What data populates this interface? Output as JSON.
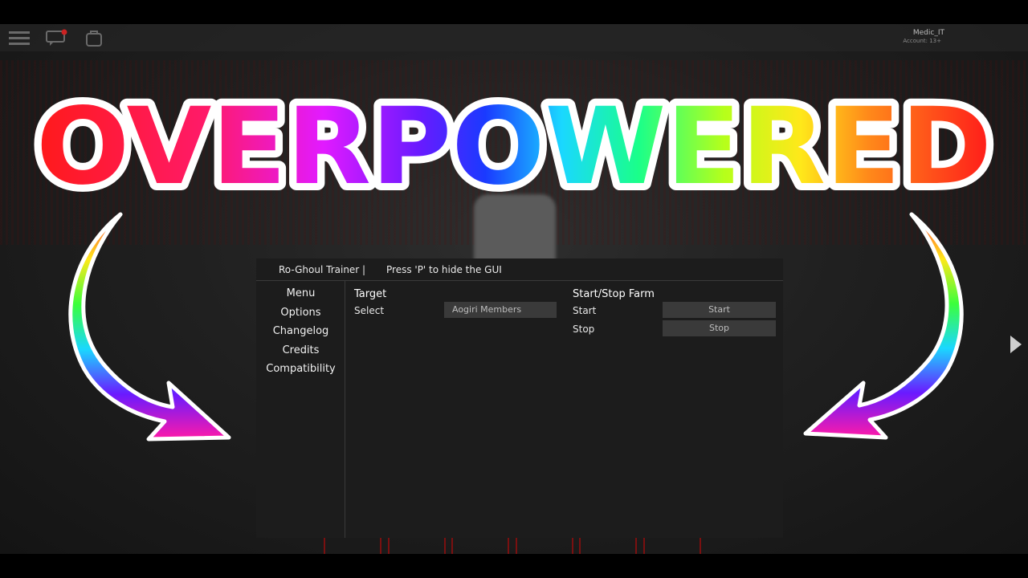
{
  "overlay": {
    "title": "OVERPOWERED"
  },
  "roblox": {
    "player_name": "Medic_IT",
    "player_sub": "Account: 13+"
  },
  "gui": {
    "title": "Ro-Ghoul Trainer |",
    "hint": "Press 'P' to hide the GUI",
    "menu": [
      {
        "label": "Menu"
      },
      {
        "label": "Options"
      },
      {
        "label": "Changelog"
      },
      {
        "label": "Credits"
      },
      {
        "label": "Compatibility"
      }
    ],
    "target": {
      "title": "Target",
      "select_label": "Select",
      "select_value": "Aogiri Members"
    },
    "farm": {
      "title": "Start/Stop Farm",
      "start_label": "Start",
      "start_button": "Start",
      "stop_label": "Stop",
      "stop_button": "Stop"
    }
  },
  "hotbar": {
    "left_icon": "S",
    "right_icon": "S"
  },
  "colors": {
    "gui_bg": "#1c1c1c",
    "button_bg": "#3a3a3a",
    "divider": "#3a3a3a",
    "hotbar_red": "#8f1414"
  }
}
